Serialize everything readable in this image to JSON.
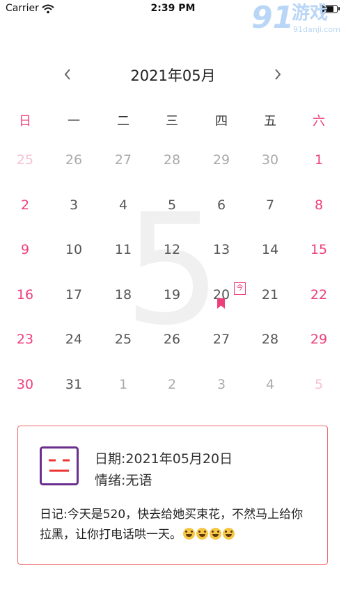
{
  "status_bar": {
    "carrier": "Carrier",
    "time": "2:39 PM",
    "battery_level": 0.9
  },
  "watermark": {
    "number": "91",
    "name": "游戏",
    "url": "91danji.com"
  },
  "calendar": {
    "title": "2021年05月",
    "background_month": "5",
    "weekdays": [
      "日",
      "一",
      "二",
      "三",
      "四",
      "五",
      "六"
    ],
    "weeks": [
      [
        "25",
        "26",
        "27",
        "28",
        "29",
        "30",
        "1"
      ],
      [
        "2",
        "3",
        "4",
        "5",
        "6",
        "7",
        "8"
      ],
      [
        "9",
        "10",
        "11",
        "12",
        "13",
        "14",
        "15"
      ],
      [
        "16",
        "17",
        "18",
        "19",
        "20",
        "21",
        "22"
      ],
      [
        "23",
        "24",
        "25",
        "26",
        "27",
        "28",
        "29"
      ],
      [
        "30",
        "31",
        "1",
        "2",
        "3",
        "4",
        "5"
      ]
    ],
    "today_badge": "今",
    "colors": {
      "weekend": "#ee3f7d",
      "normal": "#555555",
      "other_month": "#aaaaaa"
    }
  },
  "diary": {
    "date_label": "日期:2021年05月20日",
    "mood_label": "情绪:无语",
    "text": "日记:今天是520，快去给她买束花，不然马上给你拉黑，让你打电话哄一天。",
    "emoji_icon": "laughing-tears-icon",
    "mood_icon": "speechless-face-icon",
    "border_color": "#ef6a6a"
  }
}
